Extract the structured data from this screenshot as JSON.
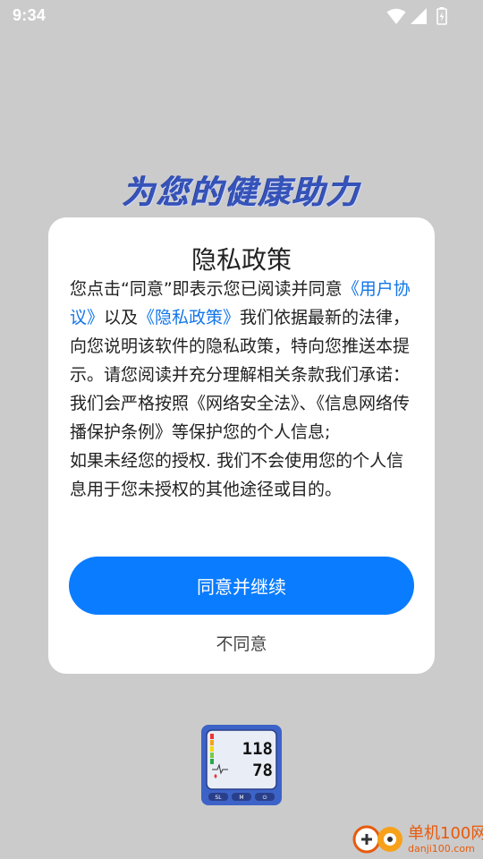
{
  "status_bar": {
    "time": "9:34"
  },
  "splash": {
    "slogan": "为您的健康助力"
  },
  "dialog": {
    "title": "隐私政策",
    "intro_before": "您点击“同意”即表示您已阅读并同意",
    "user_agreement_link": "《用户协议》",
    "and_text": "以及",
    "privacy_policy_link": "《隐私政策》",
    "intro_after": "我们依据最新的法律，向您说明该软件的隐私政策，特向您推送本提示。请您阅读并充分理解相关条款我们承诺：",
    "paragraph_2": "我们会严格按照《网络安全法》、《信息网络传播保护条例》等保护您的个人信息;",
    "paragraph_3": "如果未经您的授权. 我们不会使用您的个人信息用于您未授权的其他途径或目的。",
    "agree_label": "同意并继续",
    "decline_label": "不同意"
  },
  "app_icon": {
    "reading_top": "118",
    "reading_bottom": "78",
    "buttons": [
      "SL",
      "M",
      "⏻"
    ]
  },
  "watermark": {
    "title": "单机100网",
    "url": "danji100.com"
  },
  "colors": {
    "accent": "#0a7cff",
    "link": "#1276e8",
    "slogan": "#3553b8",
    "watermark": "#e85a0c"
  }
}
